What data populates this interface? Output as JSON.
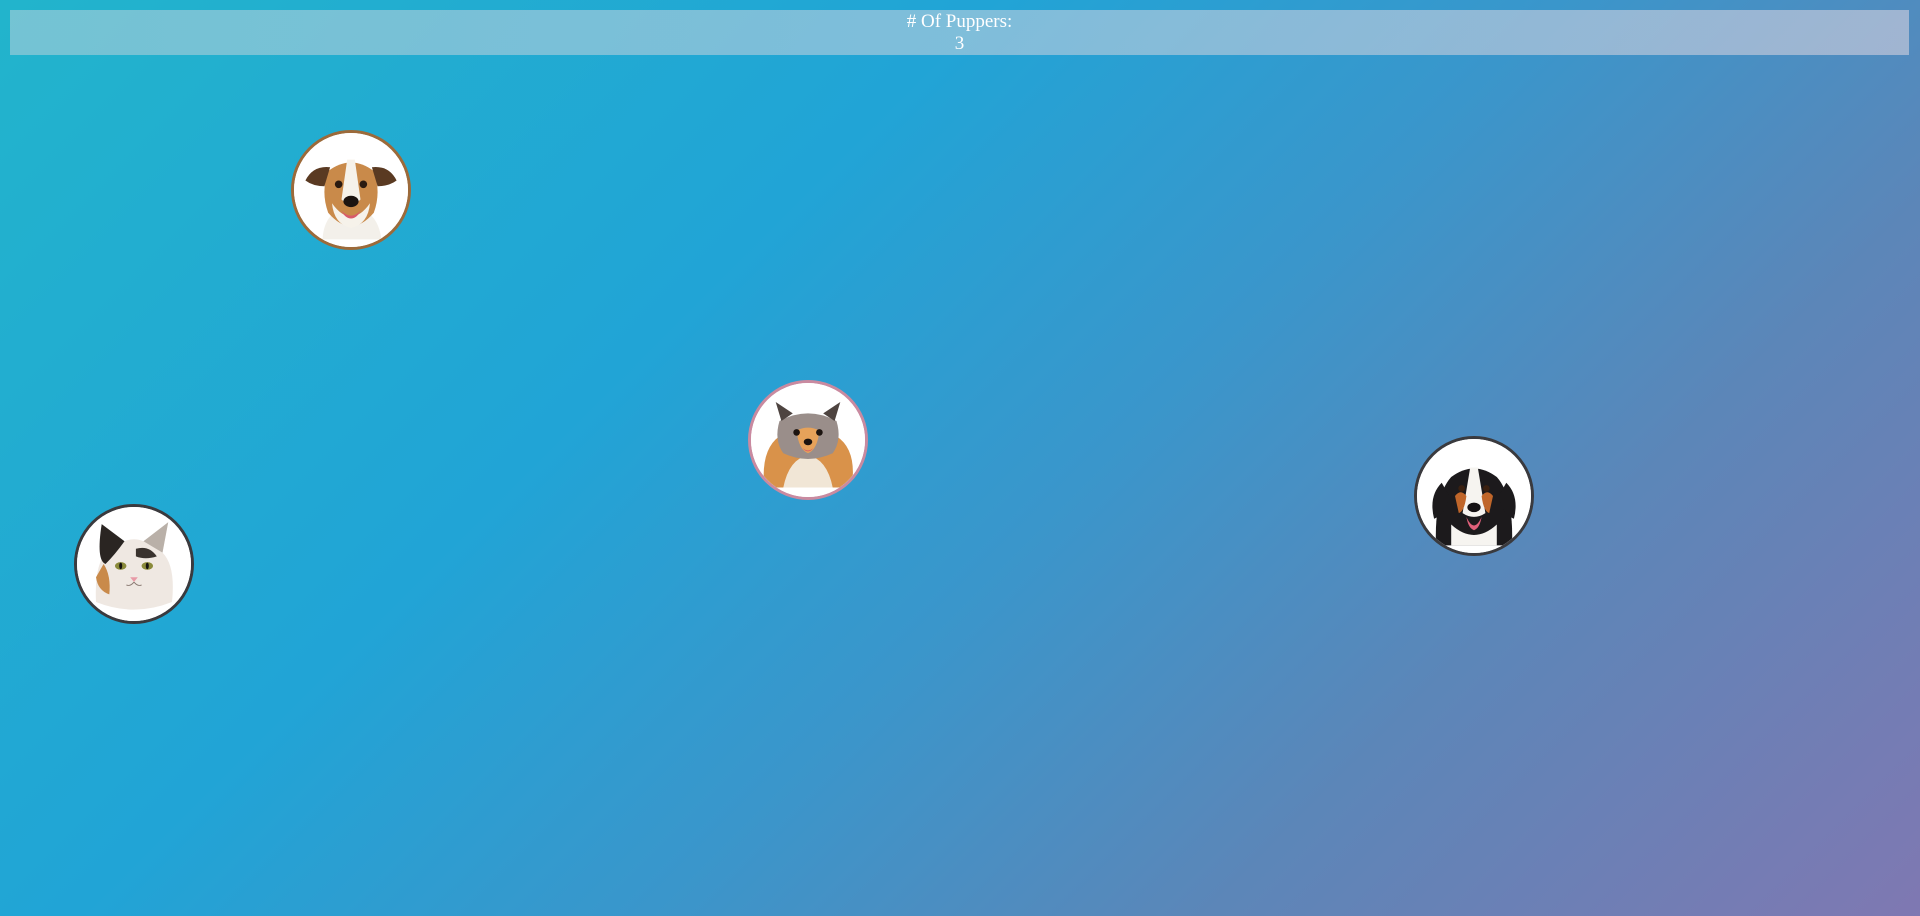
{
  "header": {
    "label": "# Of Puppers:",
    "count": "3"
  },
  "colors": {
    "background_start": "#22b4cc",
    "background_end": "#7f78b2",
    "text": "#ffffff"
  },
  "animals": [
    {
      "name": "jack-russell-terrier",
      "icon": "dog-icon"
    },
    {
      "name": "pomeranian",
      "icon": "dog-icon"
    },
    {
      "name": "bernese-mountain-dog",
      "icon": "dog-icon"
    },
    {
      "name": "calico-cat",
      "icon": "cat-icon"
    }
  ]
}
